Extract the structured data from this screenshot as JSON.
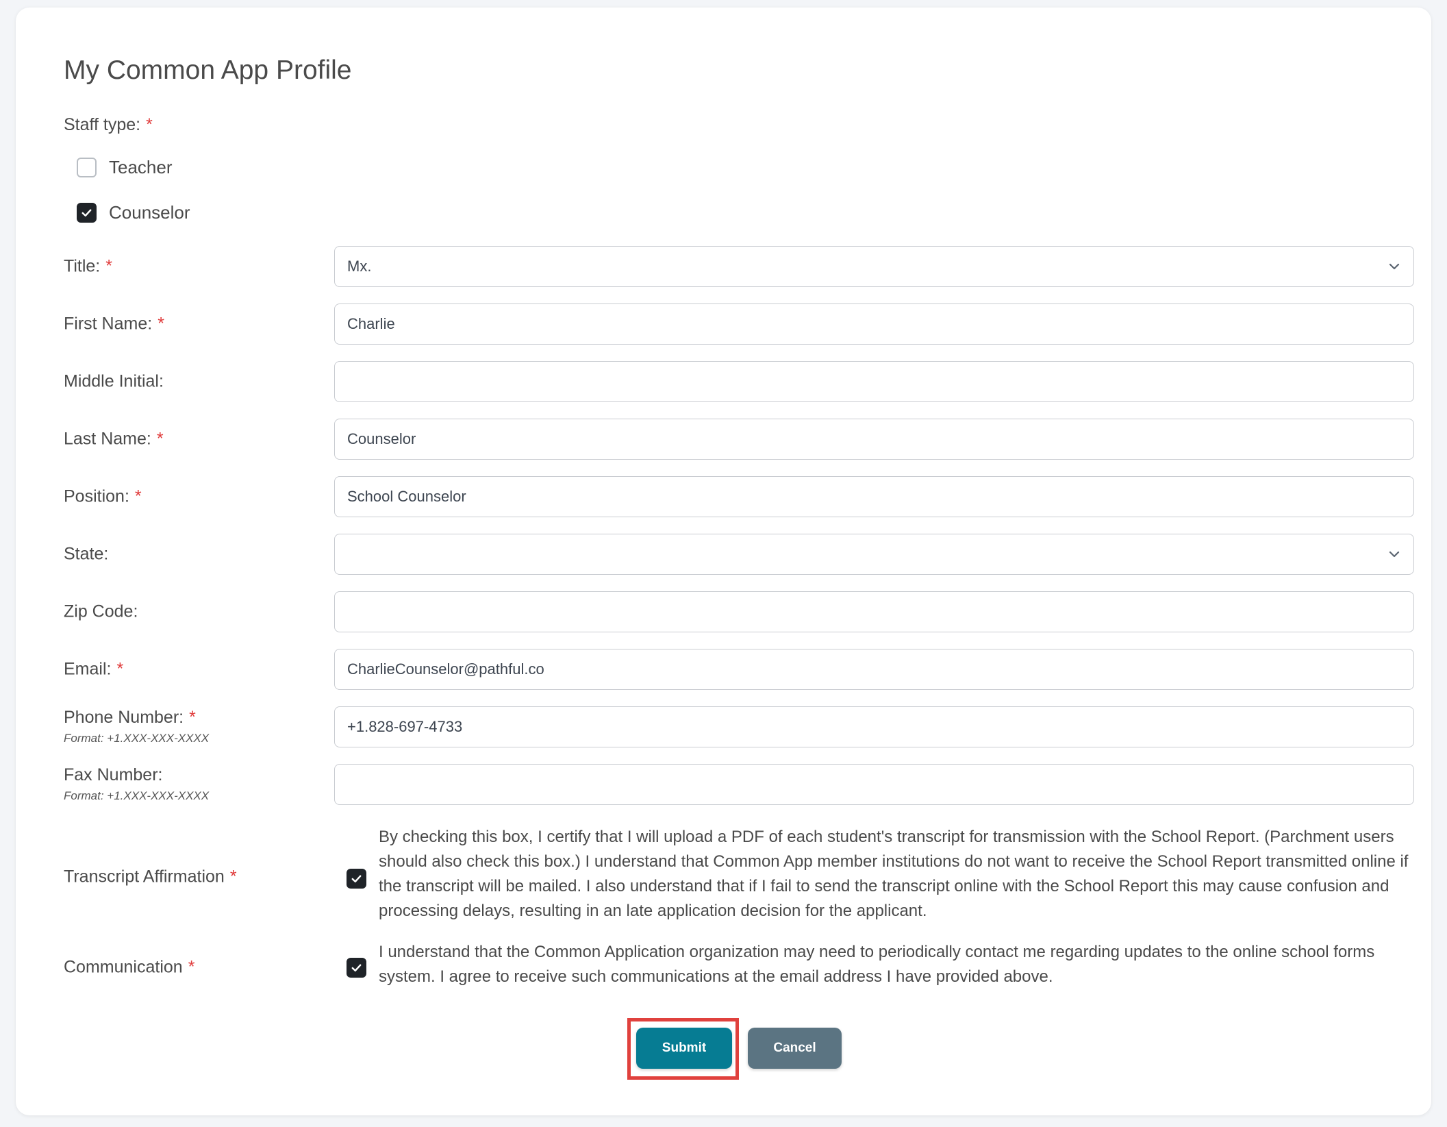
{
  "page": {
    "title": "My Common App Profile"
  },
  "staff_type": {
    "label": "Staff type:",
    "required_mark": "*",
    "options": [
      {
        "label": "Teacher",
        "checked": false
      },
      {
        "label": "Counselor",
        "checked": true
      }
    ]
  },
  "fields": {
    "title": {
      "label": "Title:",
      "required_mark": "*",
      "value": "Mx.",
      "type": "select"
    },
    "first_name": {
      "label": "First Name:",
      "required_mark": "*",
      "value": "Charlie"
    },
    "middle_initial": {
      "label": "Middle Initial:",
      "value": ""
    },
    "last_name": {
      "label": "Last Name:",
      "required_mark": "*",
      "value": "Counselor"
    },
    "position": {
      "label": "Position:",
      "required_mark": "*",
      "value": "School Counselor"
    },
    "state": {
      "label": "State:",
      "value": "",
      "type": "select"
    },
    "zip_code": {
      "label": "Zip Code:",
      "value": ""
    },
    "email": {
      "label": "Email:",
      "required_mark": "*",
      "value": "CharlieCounselor@pathful.co"
    },
    "phone": {
      "label": "Phone Number:",
      "required_mark": "*",
      "hint": "Format: +1.XXX-XXX-XXXX",
      "value": "+1.828-697-4733"
    },
    "fax": {
      "label": "Fax Number:",
      "hint": "Format: +1.XXX-XXX-XXXX",
      "value": ""
    }
  },
  "transcript_affirmation": {
    "label": "Transcript Affirmation",
    "required_mark": "*",
    "checked": true,
    "text": "By checking this box, I certify that I will upload a PDF of each student's transcript for transmission with the School Report. (Parchment users should also check this box.) I understand that Common App member institutions do not want to receive the School Report transmitted online if the transcript will be mailed. I also understand that if I fail to send the transcript online with the School Report this may cause confusion and processing delays, resulting in an late application decision for the applicant."
  },
  "communication": {
    "label": "Communication",
    "required_mark": "*",
    "checked": true,
    "text": "I understand that the Common Application organization may need to periodically contact me regarding updates to the online school forms system. I agree to receive such communications at the email address I have provided above."
  },
  "actions": {
    "submit_label": "Submit",
    "cancel_label": "Cancel"
  },
  "colors": {
    "submit_bg": "#067c93",
    "cancel_bg": "#5b7482",
    "required": "#e03a3a",
    "highlight": "#e0413d"
  }
}
